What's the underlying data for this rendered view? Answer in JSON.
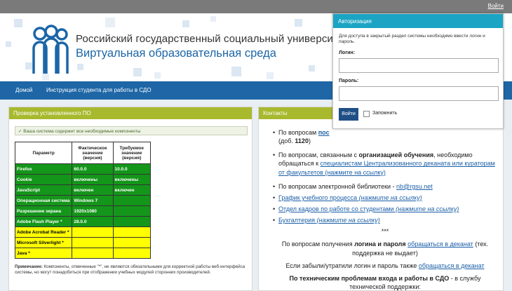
{
  "topbar": {
    "login_link": "Войти"
  },
  "header": {
    "university": "Российский государственный социальный университет",
    "system": "Виртуальная образовательная среда"
  },
  "nav": {
    "items": [
      "Домой",
      "Инструкция студента для работы в СДО"
    ]
  },
  "check_panel": {
    "title": "Проверка установленного ПО",
    "ok_message": "✓ Ваша система содержит все необходимые компоненты",
    "columns": [
      "Параметр",
      "Фактическое значение (версия)",
      "Требуемое значение (версия)"
    ],
    "rows": [
      {
        "param": "Firefox",
        "actual": "60.0.0",
        "required": "10.0.0",
        "status": "ok"
      },
      {
        "param": "Cookie",
        "actual": "включены",
        "required": "включены",
        "status": "ok"
      },
      {
        "param": "JavaScript",
        "actual": "включен",
        "required": "включен",
        "status": "ok"
      },
      {
        "param": "Операционная система",
        "actual": "Windows 7",
        "required": "",
        "status": "ok"
      },
      {
        "param": "Разрешение экрана",
        "actual": "1920x1080",
        "required": "",
        "status": "ok"
      },
      {
        "param": "Adobe Flash Player *",
        "actual": "28.0.0",
        "required": "",
        "status": "ok"
      },
      {
        "param": "Adobe Acrobat Reader *",
        "actual": "",
        "required": "",
        "status": "warn"
      },
      {
        "param": "Microsoft Silverlight *",
        "actual": "",
        "required": "",
        "status": "warn"
      },
      {
        "param": "Java *",
        "actual": "",
        "required": "",
        "status": "warn"
      }
    ],
    "note_label": "Примечание:",
    "note_text": " Компоненты, отмеченные \"*\", не являются обязательными для корректной работы веб-интерфейса системы, но могут понадобиться при отображении учебных модулей сторонних производителей."
  },
  "contacts_panel": {
    "title": "Контакты",
    "i1_a": "По вопросам ",
    "i1_link": "пос",
    "i1_b": "(доб. ",
    "i1_ext": "1120",
    "i1_c": ")",
    "i2_a": "По вопросам, связанным с ",
    "i2_bold": "организацией обучения",
    "i2_b": ", необходимо обращаться к ",
    "i2_link": "специалистам Централизованного деканата или кураторам от факультетов (нажмите на ссылку)",
    "i3_a": "По вопросам электронной библиотеки - ",
    "i3_link": "nb@rgsu.net",
    "i4_link": "График учебного процесса",
    "i4_em": "(нажмите на ссылку)",
    "i5_link": "Отдел кадров по работе со студентами",
    "i5_em": "(нажмите на ссылку)",
    "i6_link": "Бухгалтерия",
    "i6_em": "(нажмите на ссылку)",
    "sep": "***",
    "p1_a": "По вопросам получения ",
    "p1_bold": "логина и пароля",
    "p1_link": "обращаться в деканат",
    "p1_b": " (тех. поддержка не выдает)",
    "p2_a": "Если забыли/утратили логин и пароль также ",
    "p2_link": "обращаться в деканат",
    "p3_bold": "По техническим проблемам входа и работы в СДО",
    "p3_b": " - в службу технической поддержки:"
  },
  "auth": {
    "title": "Авторизация",
    "description": "Для доступа в закрытый раздел системы необходимо ввести логин и пароль.",
    "login_label": "Логин:",
    "login_value": "",
    "password_label": "Пароль:",
    "password_value": "",
    "submit": "Войти",
    "remember": "Запомнить"
  },
  "colors": {
    "nav": "#1e66a6",
    "panel_header": "#a8b92e",
    "auth_header": "#1ba4c4",
    "ok_row": "#14961a",
    "optional_row": "#ffff00"
  }
}
